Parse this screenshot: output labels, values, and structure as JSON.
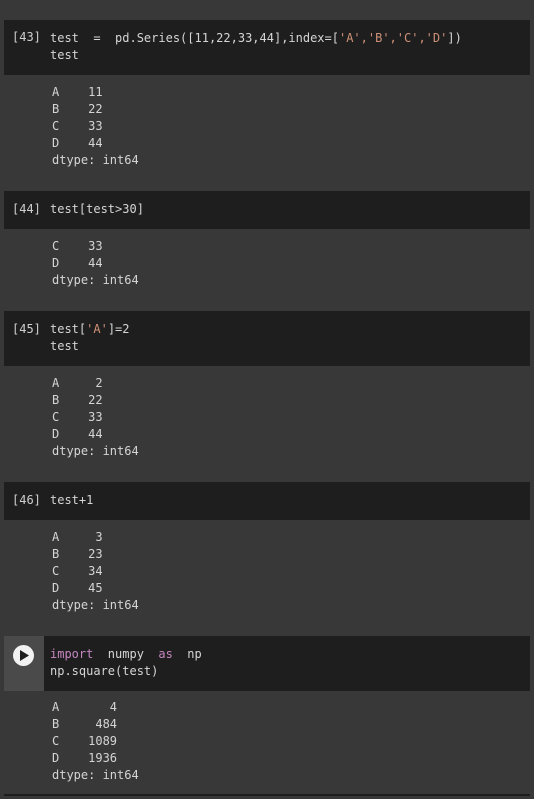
{
  "cells": [
    {
      "prompt": "[43]",
      "code": [
        "test  =  pd.Series([11,22,33,44],index=[",
        "'A','B','C','D'",
        "])",
        "test"
      ],
      "output": [
        "A    11",
        "B    22",
        "C    33",
        "D    44",
        "dtype: int64"
      ]
    },
    {
      "prompt": "[44]",
      "code": [
        "test[test>30]"
      ],
      "output": [
        "C    33",
        "D    44",
        "dtype: int64"
      ]
    },
    {
      "prompt": "[45]",
      "code": [
        "test[",
        "'A'",
        "]=2",
        "test"
      ],
      "output": [
        "A     2",
        "B    22",
        "C    33",
        "D    44",
        "dtype: int64"
      ]
    },
    {
      "prompt": "[46]",
      "code": [
        "test+1"
      ],
      "output": [
        "A     3",
        "B    23",
        "C    34",
        "D    45",
        "dtype: int64"
      ]
    },
    {
      "code_kw1": "import",
      "code_mid": "  numpy  ",
      "code_kw2": "as",
      "code_end": "  np",
      "code2": "np.square(test)",
      "output": [
        "A       4",
        "B     484",
        "C    1089",
        "D    1936",
        "dtype: int64"
      ]
    }
  ],
  "colors": {
    "background": "#383838",
    "code_bg": "#1e1e1e",
    "string": "#ce9178",
    "keyword": "#c586c0"
  },
  "icons": {
    "run": "play-circle-icon"
  }
}
